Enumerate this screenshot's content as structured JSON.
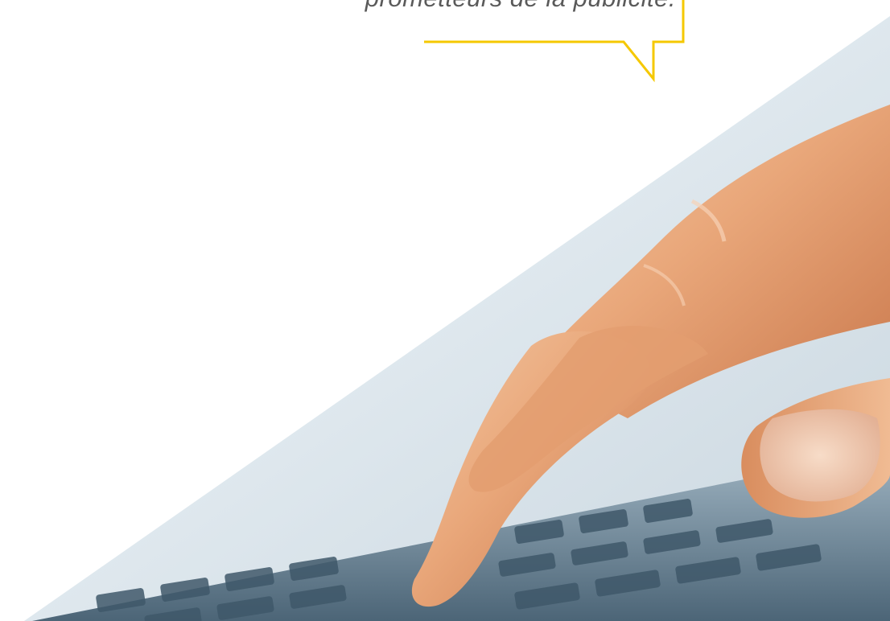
{
  "quote": {
    "text": "prometteurs de la publicité."
  },
  "colors": {
    "accent": "#f5c800",
    "quote_text": "#5a5a5a",
    "background": "#ffffff"
  },
  "photo": {
    "icon": "hand-typing-on-keyboard-image"
  }
}
